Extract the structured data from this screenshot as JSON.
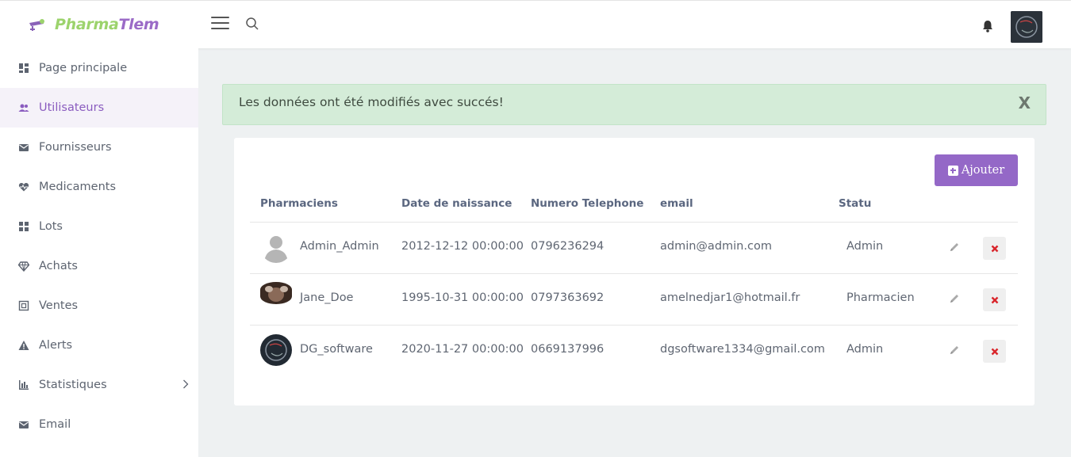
{
  "header": {
    "logo_part1": "Pharma",
    "logo_part2": "Tlem"
  },
  "sidebar": {
    "items": [
      {
        "label": "Page principale",
        "icon": "dashboard-icon"
      },
      {
        "label": "Utilisateurs",
        "icon": "users-icon",
        "active": true
      },
      {
        "label": "Fournisseurs",
        "icon": "envelope-icon"
      },
      {
        "label": "Medicaments",
        "icon": "heart-pulse-icon"
      },
      {
        "label": "Lots",
        "icon": "grid-icon"
      },
      {
        "label": "Achats",
        "icon": "diamond-icon"
      },
      {
        "label": "Ventes",
        "icon": "box-icon"
      },
      {
        "label": "Alerts",
        "icon": "warning-icon"
      },
      {
        "label": "Statistiques",
        "icon": "bar-chart-icon"
      },
      {
        "label": "Email",
        "icon": "envelope-icon"
      }
    ]
  },
  "alert": {
    "message": "Les données ont été modifiés avec succés!",
    "close": "X"
  },
  "table": {
    "add_label": "Ajouter",
    "headers": [
      "Pharmaciens",
      "Date de naissance",
      "Numero Telephone",
      "email",
      "Statu"
    ],
    "rows": [
      {
        "name": "Admin_Admin",
        "birth": "2012-12-12 00:00:00",
        "phone": "0796236294",
        "email": "admin@admin.com",
        "status": "Admin"
      },
      {
        "name": "Jane_Doe",
        "birth": "1995-10-31 00:00:00",
        "phone": "0797363692",
        "email": "amelnedjar1@hotmail.fr",
        "status": "Pharmacien"
      },
      {
        "name": "DG_software",
        "birth": "2020-11-27 00:00:00",
        "phone": "0669137996",
        "email": "dgsoftware1334@gmail.com",
        "status": "Admin"
      }
    ]
  },
  "colors": {
    "accent": "#9468c7",
    "logo_green": "#9cd36c",
    "alert_bg": "#d4ecd8",
    "delete_red": "#d9262c"
  }
}
